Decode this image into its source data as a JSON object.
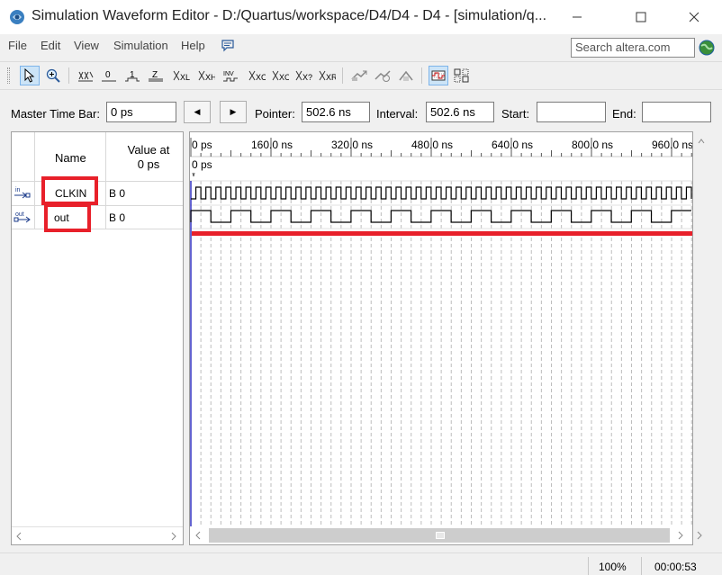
{
  "window": {
    "title": "Simulation Waveform Editor - D:/Quartus/workspace/D4/D4 - D4 - [simulation/q..."
  },
  "menu": {
    "items": [
      "File",
      "Edit",
      "View",
      "Simulation",
      "Help"
    ],
    "search_placeholder": "Search altera.com"
  },
  "toolbar": {
    "icons": [
      "selection-tool-icon",
      "zoom-tool-icon",
      "unassigned-value-icon",
      "forcing-low-icon",
      "forcing-high-icon",
      "high-impedance-icon",
      "weak-low-icon",
      "weak-high-icon",
      "invert-icon",
      "count-value-icon",
      "clock-value-icon",
      "forcing-value-icon",
      "random-values-icon",
      "run-functional-simulation-icon",
      "run-timing-simulation-icon",
      "generate-netlist-icon",
      "snap-to-grid-icon",
      "group-icon"
    ],
    "labels": {
      "zero": "0",
      "one": "1",
      "z": "Z",
      "xl": "XL",
      "xh": "XH",
      "inv": "INV",
      "xc": "XC",
      "xo": "XO",
      "xq": "X?",
      "xr": "XR"
    }
  },
  "timebar": {
    "master_label": "Master Time Bar:",
    "master_value": "0 ps",
    "prev_label": "◀",
    "next_label": "▶",
    "pointer_label": "Pointer:",
    "pointer_value": "502.6 ns",
    "interval_label": "Interval:",
    "interval_value": "502.6 ns",
    "start_label": "Start:",
    "start_value": "",
    "end_label": "End:",
    "end_value": ""
  },
  "signal_table": {
    "name_header": "Name",
    "value_header_line1": "Value at",
    "value_header_line2": "0 ps",
    "signals": [
      {
        "dir": "in",
        "name": "CLKIN",
        "value": "B 0"
      },
      {
        "dir": "out",
        "name": "out",
        "value": "B 0"
      }
    ]
  },
  "waveform": {
    "timeline_labels": [
      "0 ps",
      "160.0 ns",
      "320.0 ns",
      "480.0 ns",
      "640.0 ns",
      "800.0 ns",
      "960.0 ns"
    ],
    "cursor_label": "0 ps",
    "clkin_cycles_visible": 50,
    "out_cycles_visible": 12.5
  },
  "status": {
    "zoom": "100%",
    "time": "00:00:53"
  },
  "colors": {
    "highlight": "#e8202a",
    "cursor": "#3030c0",
    "selected_tool": "#cce4f7"
  }
}
